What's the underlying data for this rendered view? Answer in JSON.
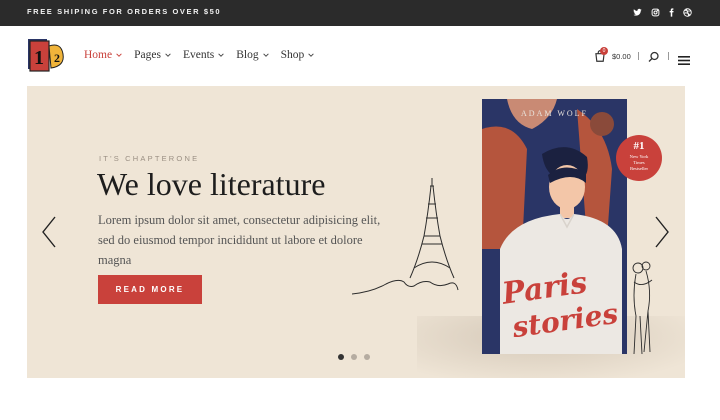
{
  "topbar": {
    "text": "FREE SHIPING FOR ORDERS OVER $50",
    "social": [
      {
        "name": "twitter-icon"
      },
      {
        "name": "instagram-icon"
      },
      {
        "name": "facebook-icon"
      },
      {
        "name": "dribbble-icon"
      }
    ]
  },
  "logo": {
    "glyph_1": "1",
    "glyph_2": "2"
  },
  "nav": {
    "items": [
      {
        "label": "Home",
        "active": true
      },
      {
        "label": "Pages",
        "active": false
      },
      {
        "label": "Events",
        "active": false
      },
      {
        "label": "Blog",
        "active": false
      },
      {
        "label": "Shop",
        "active": false
      }
    ]
  },
  "cart": {
    "count": "0",
    "total": "$0.00"
  },
  "hero": {
    "pretitle": "IT'S CHAPTERONE",
    "title": "We love literature",
    "description": "Lorem ipsum dolor sit amet, consectetur adipisicing elit, sed do eiusmod tempor incididunt ut labore et dolore magna",
    "button": "READ MORE",
    "slides": 3,
    "active_slide": 1
  },
  "book": {
    "author": "ADAM WOLF",
    "title_line1": "Paris",
    "title_line2": "stories",
    "badge_num": "#1",
    "badge_text_1": "New York",
    "badge_text_2": "Times",
    "badge_text_3": "Bestseller"
  },
  "colors": {
    "accent": "#c9413b",
    "topbar": "#2b2b2b",
    "hero_bg": "#efe5d6",
    "book_navy": "#2a3566"
  }
}
